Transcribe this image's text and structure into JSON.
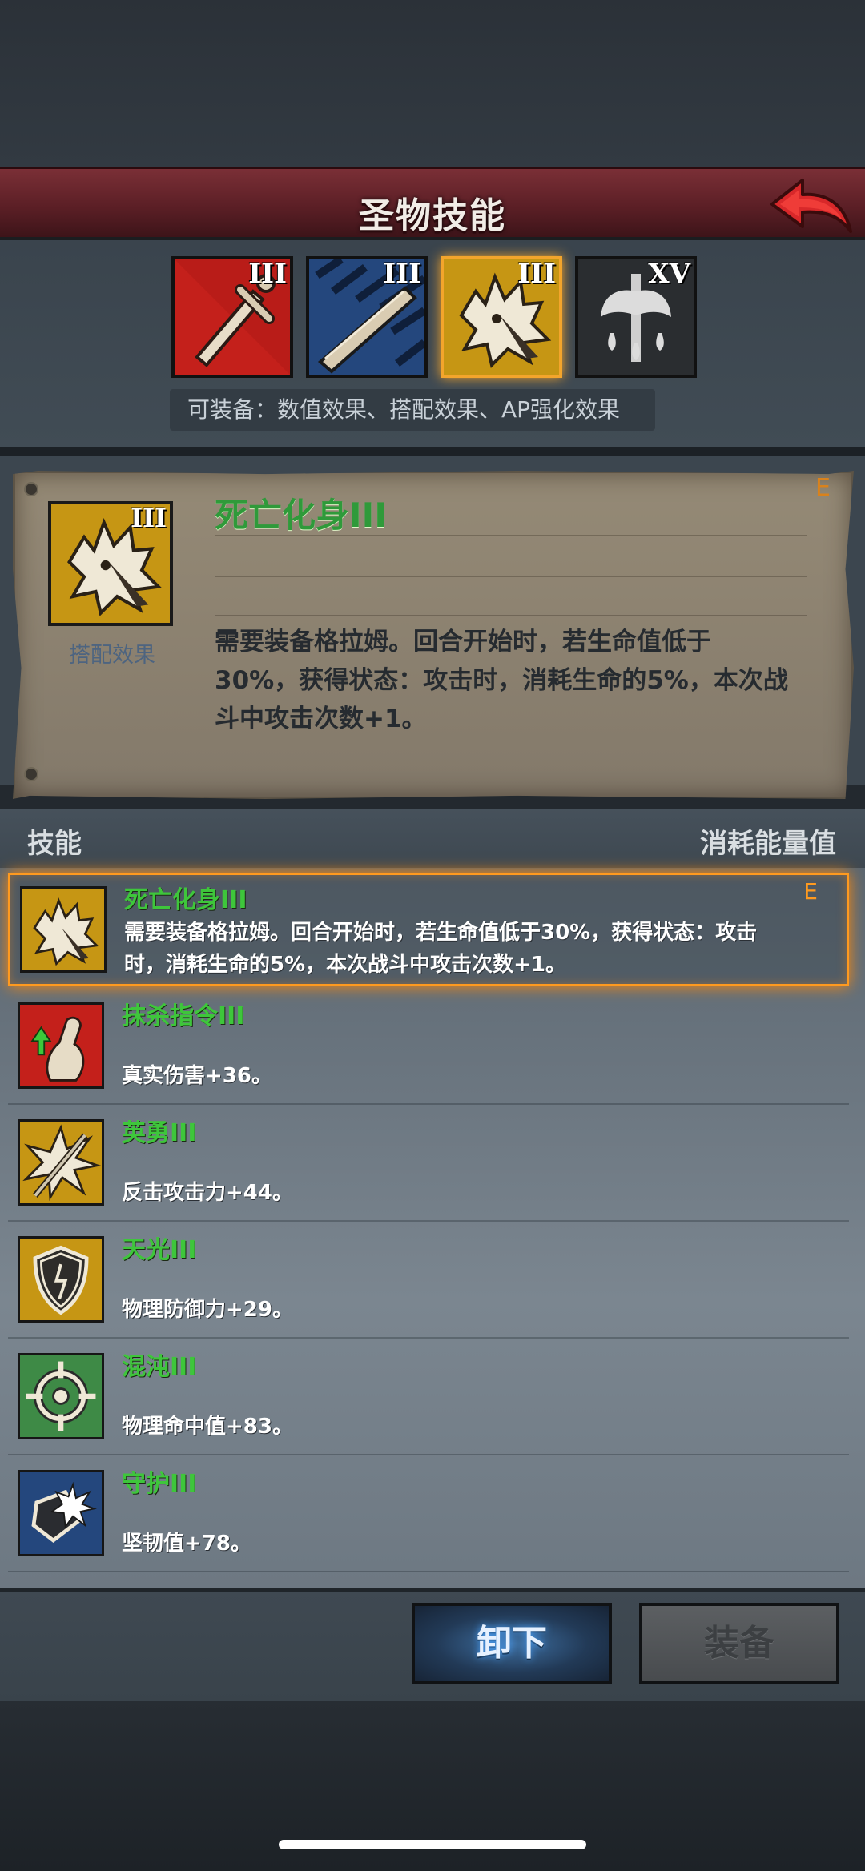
{
  "header": {
    "title": "圣物技能"
  },
  "relics": [
    {
      "icon": "sword-icon",
      "tier": "III",
      "color": "#c8231d"
    },
    {
      "icon": "blade-icon",
      "tier": "III",
      "color": "#2b4f86"
    },
    {
      "icon": "beast-skull-icon",
      "tier": "III",
      "color": "#c89a16",
      "selected": true
    },
    {
      "icon": "axe-icon",
      "tier": "XV",
      "color": "#2c2f32"
    }
  ],
  "equip_hint": "可装备：数值效果、搭配效果、AP强化效果",
  "detail": {
    "name": "死亡化身III",
    "rank": "E",
    "type": "搭配效果",
    "icon_tier": "III",
    "description": "需要装备格拉姆。回合开始时，若生命值低于30%，获得状态：攻击时，消耗生命的5%，本次战斗中攻击次数+1。"
  },
  "list_header": {
    "left": "技能",
    "right": "消耗能量值"
  },
  "skills": [
    {
      "name": "死亡化身III",
      "desc": "需要装备格拉姆。回合开始时，若生命值低于30%，获得状态：攻击时，消耗生命的5%，本次战斗中攻击次数+1。",
      "rank": "E",
      "icon": "beast-skull-icon",
      "color": "#c89a16"
    },
    {
      "name": "抹杀指令III",
      "desc": "真实伤害+36。",
      "icon": "strike-arm-icon",
      "color": "#c8231d"
    },
    {
      "name": "英勇III",
      "desc": "反击攻击力+44。",
      "icon": "burst-spear-icon",
      "color": "#c89a16"
    },
    {
      "name": "天光III",
      "desc": "物理防御力+29。",
      "icon": "shield-icon",
      "color": "#c89a16"
    },
    {
      "name": "混沌III",
      "desc": "物理命中值+83。",
      "icon": "crosshair-icon",
      "color": "#3f8a47"
    },
    {
      "name": "守护III",
      "desc": "坚韧值+78。",
      "icon": "guard-burst-icon",
      "color": "#2b4f86"
    }
  ],
  "buttons": {
    "unequip": "卸下",
    "equip": "装备"
  }
}
